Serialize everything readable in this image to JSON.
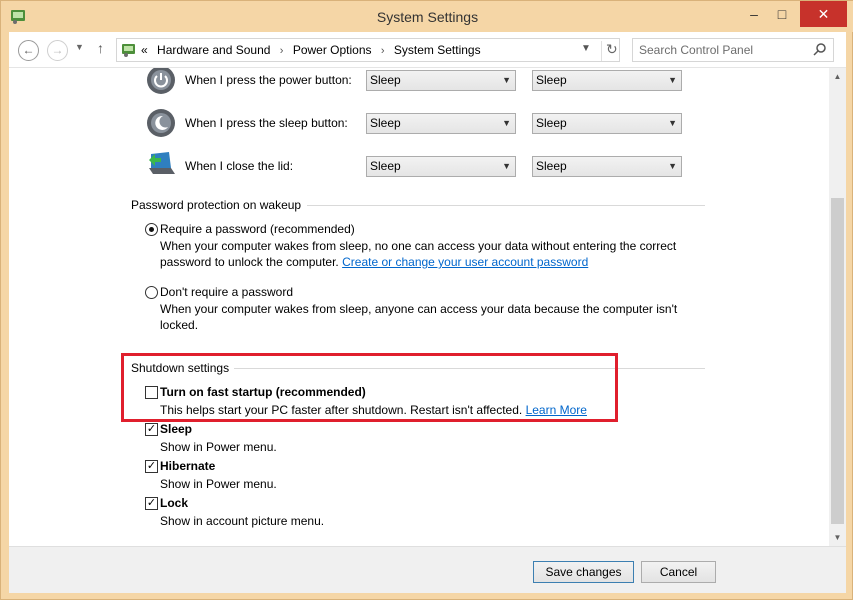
{
  "window": {
    "title": "System Settings",
    "controls": {
      "minimize": "–",
      "maximize": "□",
      "close": "✕"
    }
  },
  "nav": {
    "back_icon": "arrow-left-icon",
    "forward_icon": "arrow-right-icon",
    "up_icon": "arrow-up-icon",
    "breadcrumbs_prefix": "«",
    "breadcrumbs": [
      "Hardware and Sound",
      "Power Options",
      "System Settings"
    ],
    "search_placeholder": "Search Control Panel"
  },
  "buttons_section": {
    "rows": [
      {
        "label": "When I press the power button:",
        "icon": "power-button-icon",
        "on_battery": "Sleep",
        "plugged_in": "Sleep"
      },
      {
        "label": "When I press the sleep button:",
        "icon": "sleep-button-icon",
        "on_battery": "Sleep",
        "plugged_in": "Sleep"
      },
      {
        "label": "When I close the lid:",
        "icon": "laptop-lid-icon",
        "on_battery": "Sleep",
        "plugged_in": "Sleep"
      }
    ]
  },
  "password_section": {
    "title": "Password protection on wakeup",
    "require": {
      "label": "Require a password (recommended)",
      "selected": true,
      "desc_line1": "When your computer wakes from sleep, no one can access your data without entering the correct",
      "desc_line2": "password to unlock the computer.",
      "link": "Create or change your user account password"
    },
    "dont_require": {
      "label": "Don't require a password",
      "selected": false,
      "desc_line1": "When your computer wakes from sleep, anyone can access your data because the computer isn't",
      "desc_line2": "locked."
    }
  },
  "shutdown_section": {
    "title": "Shutdown settings",
    "fast_startup": {
      "label": "Turn on fast startup (recommended)",
      "checked": false,
      "desc": "This helps start your PC faster after shutdown. Restart isn't affected.",
      "link": "Learn More"
    },
    "sleep": {
      "label": "Sleep",
      "checked": true,
      "desc": "Show in Power menu."
    },
    "hibernate": {
      "label": "Hibernate",
      "checked": true,
      "desc": "Show in Power menu."
    },
    "lock": {
      "label": "Lock",
      "checked": true,
      "desc": "Show in account picture menu."
    }
  },
  "footer": {
    "save": "Save changes",
    "cancel": "Cancel"
  },
  "colors": {
    "window_frame": "#f5d6a6",
    "highlight_box": "#e01f2d",
    "link": "#0066cc",
    "close_button": "#c7322b"
  }
}
